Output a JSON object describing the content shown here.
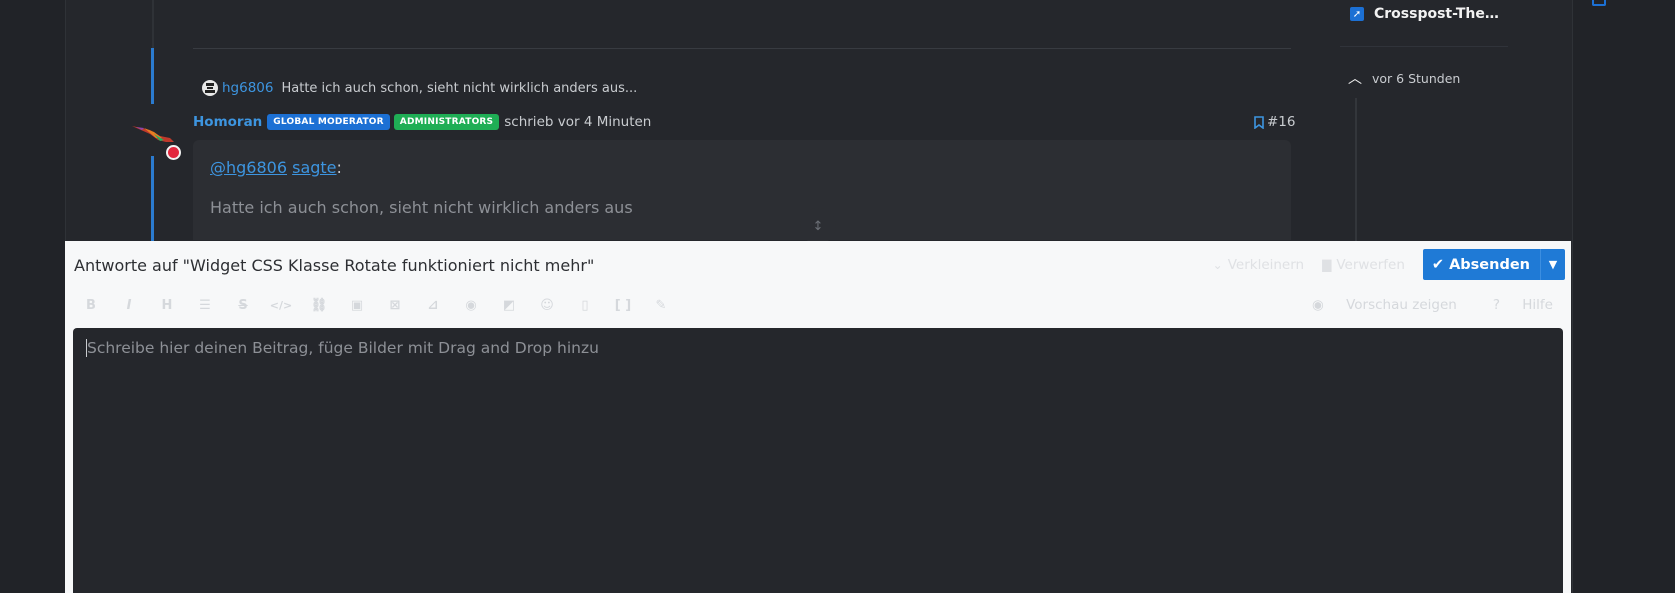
{
  "thread": {
    "reply_ref": {
      "user": "hg6806",
      "text": "Hatte ich auch schon, sieht nicht wirklich anders aus..."
    },
    "post": {
      "author": "Homoran",
      "badges": [
        "GLOBAL MODERATOR",
        "ADMINISTRATORS"
      ],
      "meta": "schrieb vor 4 Minuten",
      "number": "#16",
      "quote_user": "@hg6806",
      "quote_said": "sagte",
      "quote_colon": ":",
      "quote_text": "Hatte ich auch schon, sieht nicht wirklich anders aus"
    }
  },
  "sidebar": {
    "item_label": "Crosspost-The…",
    "time_label": "vor 6 Stunden"
  },
  "editor": {
    "title": "Antworte auf \"Widget CSS Klasse Rotate funktioniert nicht mehr\"",
    "minimize_label": "Verkleinern",
    "discard_label": "Verwerfen",
    "submit_label": "Absenden",
    "preview_label": "Vorschau zeigen",
    "help_label": "Hilfe",
    "placeholder": "Schreibe hier deinen Beitrag, füge Bilder mit Drag and Drop hinzu",
    "toolbar": [
      "B",
      "I",
      "H",
      "list",
      "S",
      "</>",
      "link",
      "image",
      "table",
      "chart",
      "eye",
      "spoiler",
      "emoji",
      "file",
      "code",
      "brush"
    ]
  },
  "colors": {
    "accent": "#1f7ad6",
    "moderator_badge": "#1c70d4",
    "admin_badge": "#1fae55",
    "online": "#e2263d"
  }
}
